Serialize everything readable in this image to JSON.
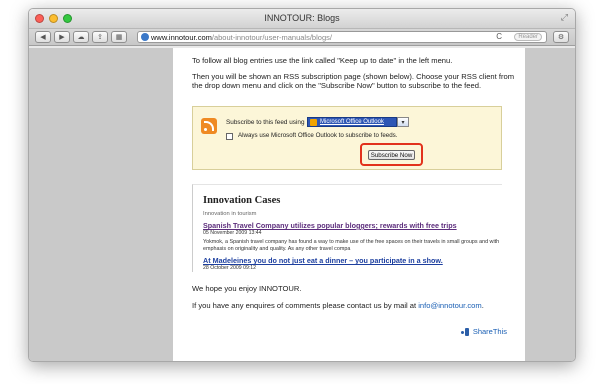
{
  "window": {
    "title": "INNOTOUR: Blogs"
  },
  "toolbar": {
    "url_domain": "www.innotour.com",
    "url_path": "/about-innotour/user-manuals/blogs/",
    "reader_label": "Reader"
  },
  "page": {
    "para1": "To follow all blog entries use the link called \"Keep up to date\" in the left menu.",
    "para2": "Then you will be shown an RSS subscription page (shown below). Choose your RSS client from the drop down menu and click on the \"Subscribe Now\" button to subscribe to the feed.",
    "rss": {
      "subscribe_label": "Subscribe to this feed using",
      "reader_option": "Microsoft Office Outlook",
      "always_label": "Always use Microsoft Office Outlook to subscribe to feeds.",
      "button": "Subscribe Now"
    },
    "feed": {
      "title": "Innovation Cases",
      "subtitle": "Innovation in tourism",
      "items": [
        {
          "title": "Spanish Travel Company utilizes popular bloggers; rewards with free trips",
          "date": "05 November 2009 13:44",
          "text": "Yokmok, a Spanish travel company has found a way to make use of the free spaces on their travels in small groups and with emphasis on originality and quality. As any other travel compa"
        },
        {
          "title": "At Madeleines you do not just eat a dinner – you participate in a show.",
          "date": "28 October 2009 09:12"
        }
      ]
    },
    "para3": "We hope you enjoy INNOTOUR.",
    "para4_prefix": "If you have any enquires of comments please contact us by mail at ",
    "para4_email": "info@innotour.com",
    "para4_suffix": ".",
    "sharethis": "ShareThis"
  }
}
